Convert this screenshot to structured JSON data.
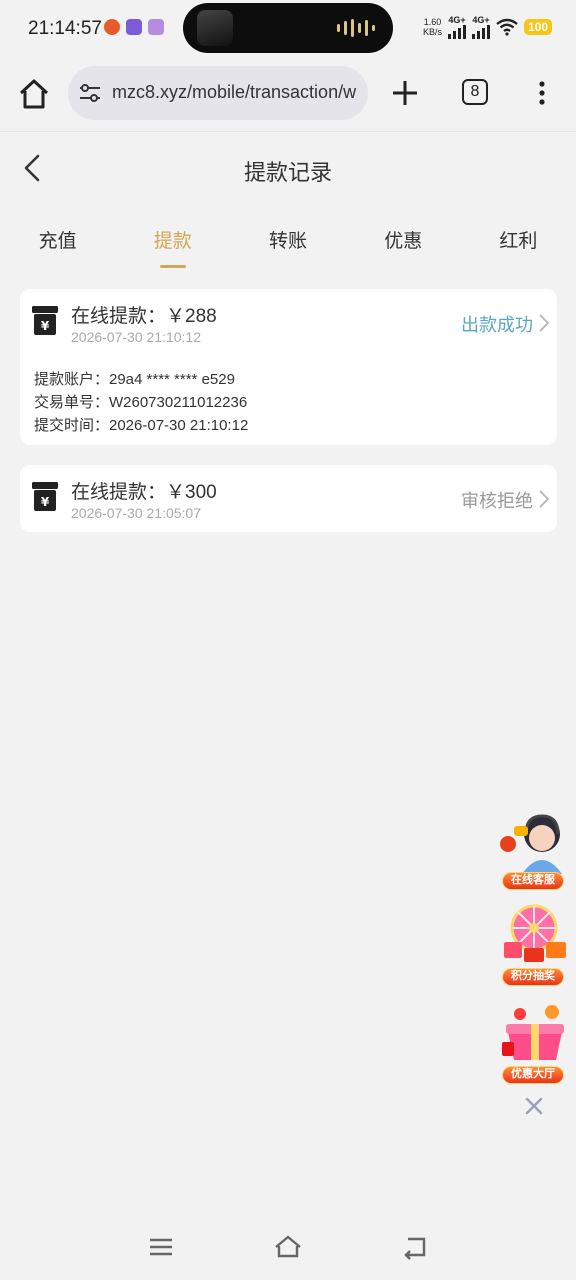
{
  "status_bar": {
    "time": "21:14:57",
    "net_speed_value": "1.60",
    "net_speed_unit": "KB/s",
    "signal_1": "4G+",
    "signal_2": "4G+",
    "battery": "100"
  },
  "browser": {
    "url": "mzc8.xyz/mobile/transaction/w",
    "tab_count": "8"
  },
  "header": {
    "title": "提款记录"
  },
  "tabs": [
    {
      "label": "充值",
      "active": false
    },
    {
      "label": "提款",
      "active": true
    },
    {
      "label": "转账",
      "active": false
    },
    {
      "label": "优惠",
      "active": false
    },
    {
      "label": "红利",
      "active": false
    }
  ],
  "records": [
    {
      "title": "在线提款：￥288",
      "time": "2026-07-30 21:10:12",
      "status": "出款成功",
      "details": [
        "提款账户：29a4 **** **** e529",
        "交易单号：W260730211012236",
        "提交时间：2026-07-30 21:10:12"
      ]
    },
    {
      "title": "在线提款：￥300",
      "time": "2026-07-30 21:05:07",
      "status": "审核拒绝"
    }
  ],
  "floating": {
    "customer_service": "在线客服",
    "lottery": "积分抽奖",
    "promo": "优惠大厅"
  },
  "colors": {
    "accent": "#d4a756",
    "success": "#5aa7c6",
    "rejected": "#999999",
    "background": "#f2f2f2"
  },
  "icons": [
    "home-icon",
    "tune-icon",
    "plus-icon",
    "tabs-icon",
    "more-icon",
    "back-icon",
    "cash-box-icon",
    "chevron-right-icon",
    "close-icon",
    "menu-icon",
    "nav-home-icon",
    "nav-back-icon"
  ]
}
